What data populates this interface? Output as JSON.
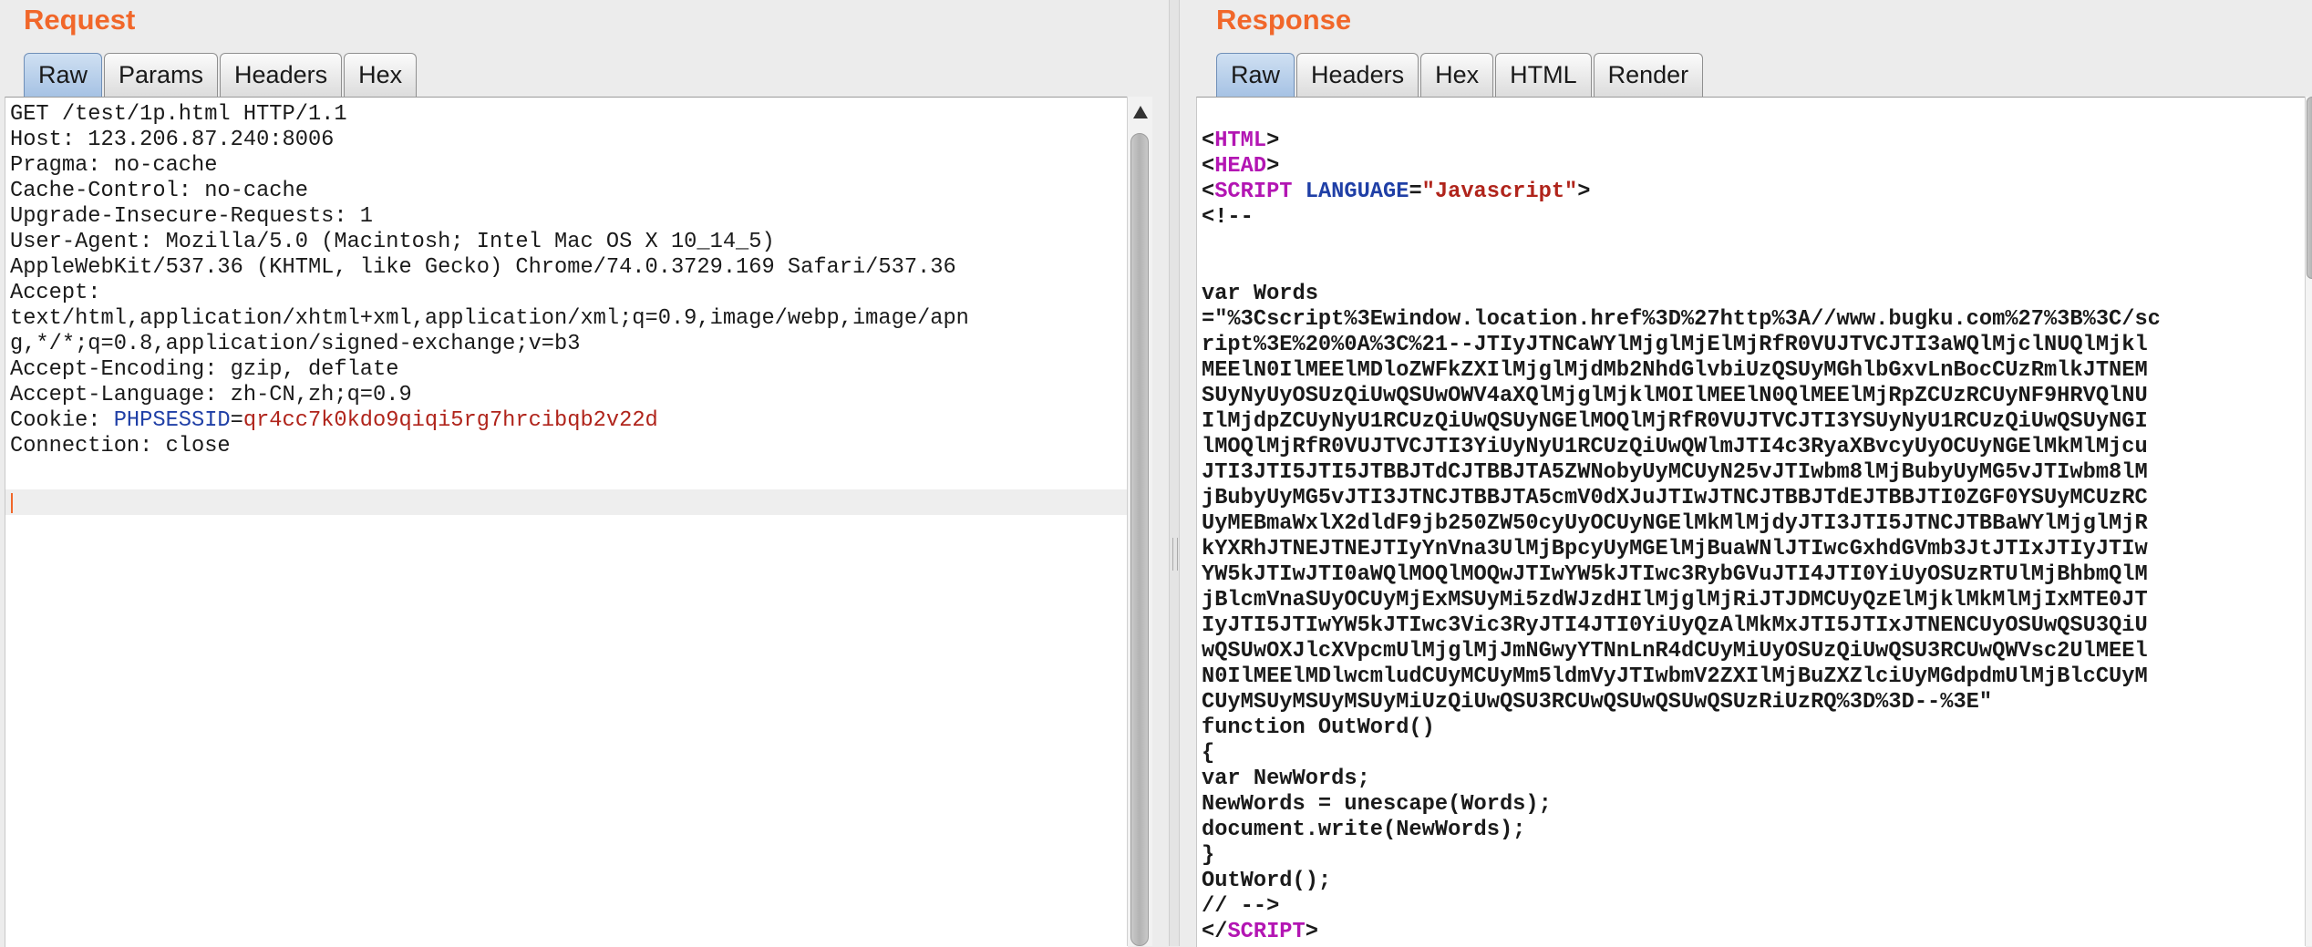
{
  "request": {
    "title": "Request",
    "tabs": [
      {
        "label": "Raw",
        "active": true
      },
      {
        "label": "Params",
        "active": false
      },
      {
        "label": "Headers",
        "active": false
      },
      {
        "label": "Hex",
        "active": false
      }
    ],
    "lines": [
      "GET /test/1p.html HTTP/1.1",
      "Host: 123.206.87.240:8006",
      "Pragma: no-cache",
      "Cache-Control: no-cache",
      "Upgrade-Insecure-Requests: 1",
      "User-Agent: Mozilla/5.0 (Macintosh; Intel Mac OS X 10_14_5)",
      "AppleWebKit/537.36 (KHTML, like Gecko) Chrome/74.0.3729.169 Safari/537.36",
      "Accept:",
      "text/html,application/xhtml+xml,application/xml;q=0.9,image/webp,image/apn",
      "g,*/*;q=0.8,application/signed-exchange;v=b3",
      "Accept-Encoding: gzip, deflate",
      "Accept-Language: zh-CN,zh;q=0.9"
    ],
    "cookie": {
      "prefix": "Cookie: ",
      "name": "PHPSESSID",
      "eq": "=",
      "value": "qr4cc7k0kdo9qiqi5rg7hrcibqb2v22d"
    },
    "connection": "Connection: close"
  },
  "response": {
    "title": "Response",
    "tabs": [
      {
        "label": "Raw",
        "active": true
      },
      {
        "label": "Headers",
        "active": false
      },
      {
        "label": "Hex",
        "active": false
      },
      {
        "label": "HTML",
        "active": false
      },
      {
        "label": "Render",
        "active": false
      }
    ],
    "html_tag": "HTML",
    "head_tag": "HEAD",
    "script_tag": "SCRIPT",
    "language_attr": "LANGUAGE",
    "language_value": "\"Javascript\"",
    "comment_open": "<!--",
    "body_lines": [
      "var Words",
      "=\"%3Cscript%3Ewindow.location.href%3D%27http%3A//www.bugku.com%27%3B%3C/sc",
      "ript%3E%20%0A%3C%21--JTIyJTNCaWYlMjglMjElMjRfR0VUJTVCJTI3aWQlMjclNUQlMjkl",
      "MEElN0IlMEElMDloZWFkZXIlMjglMjdMb2NhdGlvbiUzQSUyMGhlbGxvLnBocCUzRmlkJTNEM",
      "SUyNyUyOSUzQiUwQSUwOWV4aXQlMjglMjklMOIlMEElN0QlMEElMjRpZCUzRCUyNF9HRVQlNU",
      "IlMjdpZCUyNyU1RCUzQiUwQSUyNGElMOQlMjRfR0VUJTVCJTI3YSUyNyU1RCUzQiUwQSUyNGI",
      "lMOQlMjRfR0VUJTVCJTI3YiUyNyU1RCUzQiUwQWlmJTI4c3RyaXBvcyUyOCUyNGElMkMlMjcu",
      "JTI3JTI5JTI5JTBBJTdCJTBBJTA5ZWNobyUyMCUyN25vJTIwbm8lMjBubyUyMG5vJTIwbm8lM",
      "jBubyUyMG5vJTI3JTNCJTBBJTA5cmV0dXJuJTIwJTNCJTBBJTdEJTBBJTI0ZGF0YSUyMCUzRC",
      "UyMEBmaWxlX2dldF9jb250ZW50cyUyOCUyNGElMkMlMjdyJTI3JTI5JTNCJTBBaWYlMjglMjR",
      "kYXRhJTNEJTNEJTIyYnVna3UlMjBpcyUyMGElMjBuaWNlJTIwcGxhdGVmb3JtJTIxJTIyJTIw",
      "YW5kJTIwJTI0aWQlMOQlMOQwJTIwYW5kJTIwc3RybGVuJTI4JTI0YiUyOSUzRTUlMjBhbmQlM",
      "jBlcmVnaSUyOCUyMjExMSUyMi5zdWJzdHIlMjglMjRiJTJDMCUyQzElMjklMkMlMjIxMTE0JT",
      "IyJTI5JTIwYW5kJTIwc3Vic3RyJTI4JTI0YiUyQzAlMkMxJTI5JTIxJTNENCUyOSUwQSU3QiU",
      "wQSUwOXJlcXVpcmUlMjglMjJmNGwyYTNnLnR4dCUyMiUyOSUzQiUwQSU3RCUwQWVsc2UlMEEl",
      "N0IlMEElMDlwcmludCUyMCUyMm5ldmVyJTIwbmV2ZXIlMjBuZXZlciUyMGdpdmUlMjBlcCUyM",
      "CUyMSUyMSUyMSUyMiUzQiUwQSU3RCUwQSUwQSUwQSUzRiUzRQ%3D%3D--%3E\"",
      "function OutWord()",
      "{",
      "var NewWords;",
      "NewWords = unescape(Words);",
      "document.write(NewWords);",
      "}",
      "OutWord();",
      "// -->"
    ]
  }
}
